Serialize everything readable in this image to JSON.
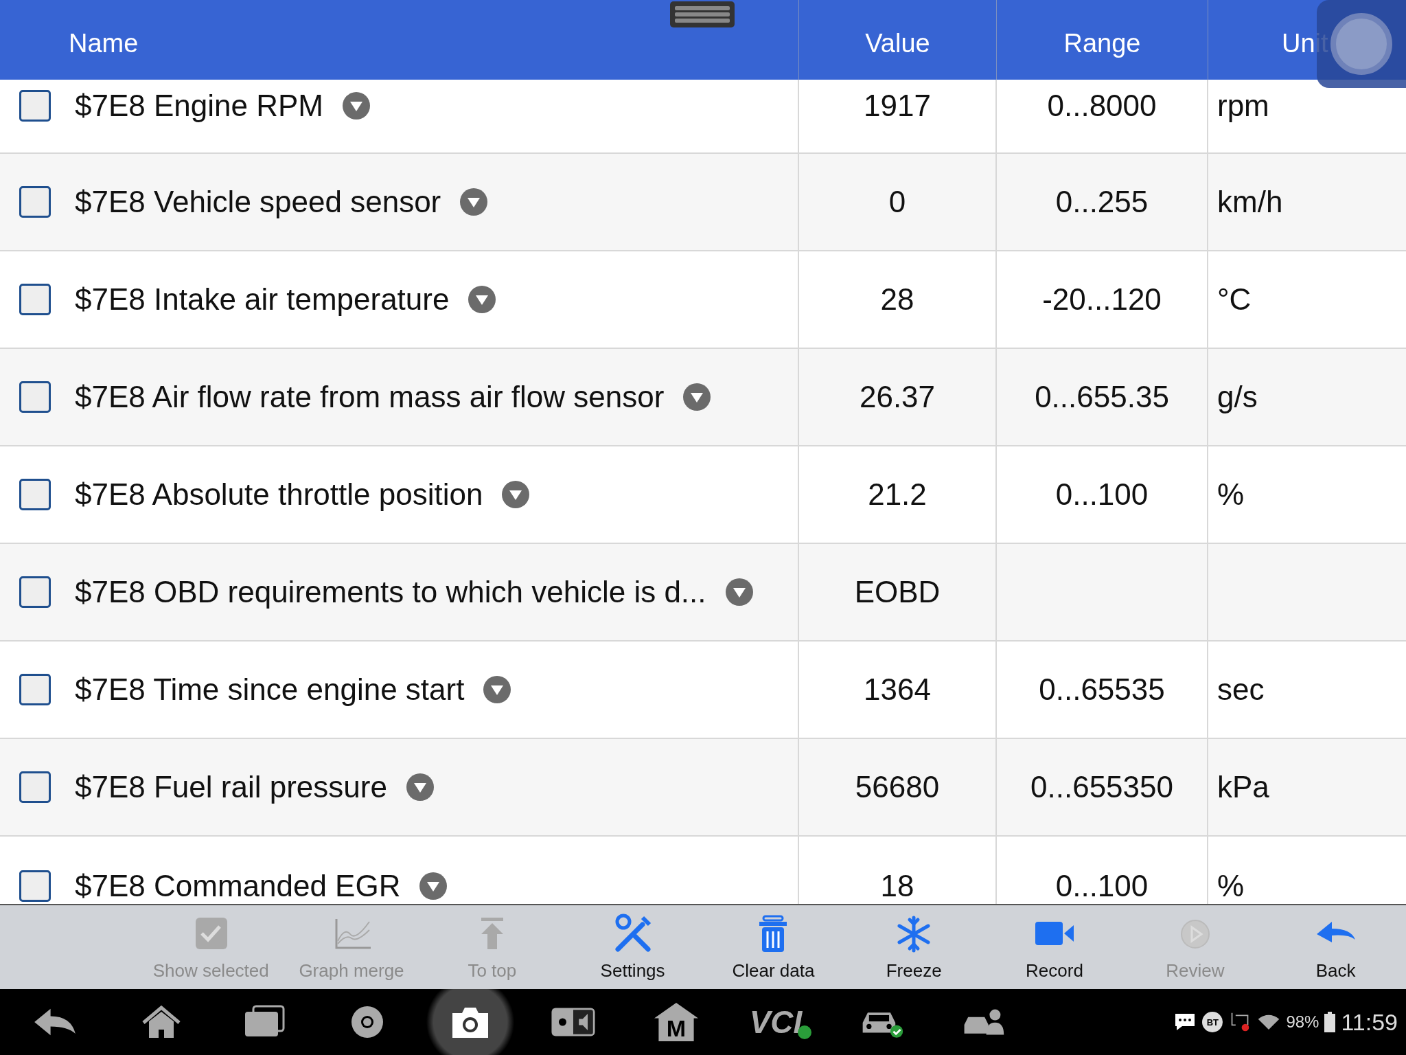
{
  "table": {
    "columns": [
      "Name",
      "Value",
      "Range",
      "Unit"
    ],
    "rows": [
      {
        "name": "$7E8 Engine RPM",
        "value": "1917",
        "range": "0...8000",
        "unit": "rpm",
        "checked": false
      },
      {
        "name": "$7E8 Vehicle speed sensor",
        "value": "0",
        "range": "0...255",
        "unit": "km/h",
        "checked": false
      },
      {
        "name": "$7E8 Intake air temperature",
        "value": "28",
        "range": "-20...120",
        "unit": "°C",
        "checked": false
      },
      {
        "name": "$7E8 Air flow rate from mass air flow sensor",
        "value": "26.37",
        "range": "0...655.35",
        "unit": "g/s",
        "checked": false
      },
      {
        "name": "$7E8 Absolute throttle position",
        "value": "21.2",
        "range": "0...100",
        "unit": "%",
        "checked": false
      },
      {
        "name": "$7E8 OBD requirements to which vehicle is d...",
        "value": "EOBD",
        "range": "",
        "unit": "",
        "checked": false
      },
      {
        "name": "$7E8 Time since engine start",
        "value": "1364",
        "range": "0...65535",
        "unit": "sec",
        "checked": false
      },
      {
        "name": "$7E8 Fuel rail pressure",
        "value": "56680",
        "range": "0...655350",
        "unit": "kPa",
        "checked": false
      },
      {
        "name": "$7E8 Commanded EGR",
        "value": "18",
        "range": "0...100",
        "unit": "%",
        "checked": false
      }
    ]
  },
  "toolbar": [
    {
      "kind": "check",
      "label": "Show selected",
      "disabled": true
    },
    {
      "kind": "graph",
      "label": "Graph merge",
      "disabled": true
    },
    {
      "kind": "totop",
      "label": "To top",
      "disabled": true
    },
    {
      "kind": "tools",
      "label": "Settings",
      "disabled": false
    },
    {
      "kind": "trash",
      "label": "Clear data",
      "disabled": false
    },
    {
      "kind": "snow",
      "label": "Freeze",
      "disabled": false
    },
    {
      "kind": "video",
      "label": "Record",
      "disabled": false
    },
    {
      "kind": "play",
      "label": "Review",
      "disabled": true
    },
    {
      "kind": "back",
      "label": "Back",
      "disabled": false
    }
  ],
  "navbar": [
    {
      "kind": "back"
    },
    {
      "kind": "home"
    },
    {
      "kind": "recents"
    },
    {
      "kind": "browser"
    },
    {
      "kind": "camera",
      "selected": true
    },
    {
      "kind": "display"
    },
    {
      "kind": "mhome",
      "label": "M"
    },
    {
      "kind": "vci",
      "label": "VCI"
    },
    {
      "kind": "car"
    },
    {
      "kind": "carperson"
    }
  ],
  "status": {
    "bt": "BT",
    "battery": "98%",
    "time": "11:59"
  }
}
